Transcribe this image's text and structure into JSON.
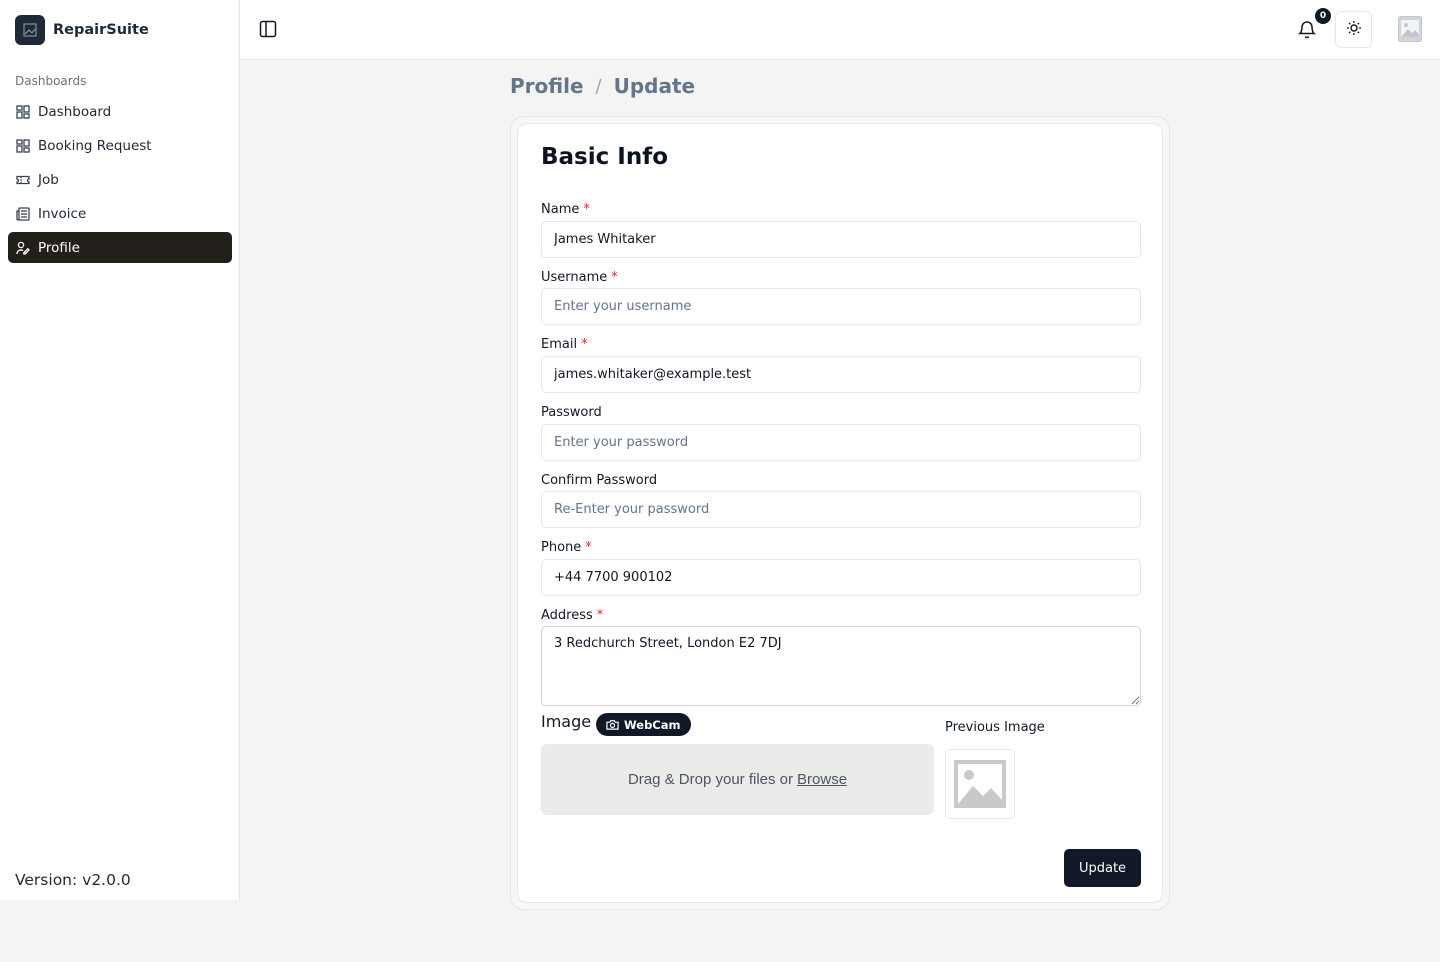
{
  "app": {
    "brand": "RepairSuite",
    "version": "Version: v2.0.0"
  },
  "sidebar": {
    "group_label": "Dashboards",
    "items": [
      {
        "label": "Dashboard",
        "icon": "grid-icon",
        "active": false
      },
      {
        "label": "Booking Request",
        "icon": "grid-icon",
        "active": false
      },
      {
        "label": "Job",
        "icon": "ticket-icon",
        "active": false
      },
      {
        "label": "Invoice",
        "icon": "newspaper-icon",
        "active": false
      },
      {
        "label": "Profile",
        "icon": "user-pen-icon",
        "active": true
      }
    ]
  },
  "header": {
    "notification_count": "0",
    "icons": [
      "sidebar-toggle-icon",
      "bell-icon",
      "sun-icon",
      "avatar-image-icon"
    ]
  },
  "breadcrumb": {
    "parent": "Profile",
    "separator": "/",
    "current": "Update"
  },
  "form": {
    "title": "Basic Info",
    "required_mark": "*",
    "name": {
      "label": "Name",
      "value": "James Whitaker",
      "placeholder": ""
    },
    "username": {
      "label": "Username",
      "value": "",
      "placeholder": "Enter your username"
    },
    "email": {
      "label": "Email",
      "value": "james.whitaker@example.test",
      "placeholder": ""
    },
    "password": {
      "label": "Password",
      "value": "",
      "placeholder": "Enter your password"
    },
    "confirm_password": {
      "label": "Confirm Password",
      "value": "",
      "placeholder": "Re-Enter your password"
    },
    "phone": {
      "label": "Phone",
      "value": "+44 7700 900102",
      "placeholder": ""
    },
    "address": {
      "label": "Address",
      "value": "3 Redchurch Street, London E2 7DJ"
    },
    "image": {
      "label": "Image",
      "webcam_label": "WebCam",
      "dropzone_text": "Drag & Drop your files or",
      "browse_label": "Browse",
      "previous_label": "Previous Image"
    },
    "submit_label": "Update"
  },
  "colors": {
    "active_nav": "#231f1b",
    "primary_button": "#111827",
    "required": "#dc2626",
    "page_bg": "#f4f4f3"
  }
}
